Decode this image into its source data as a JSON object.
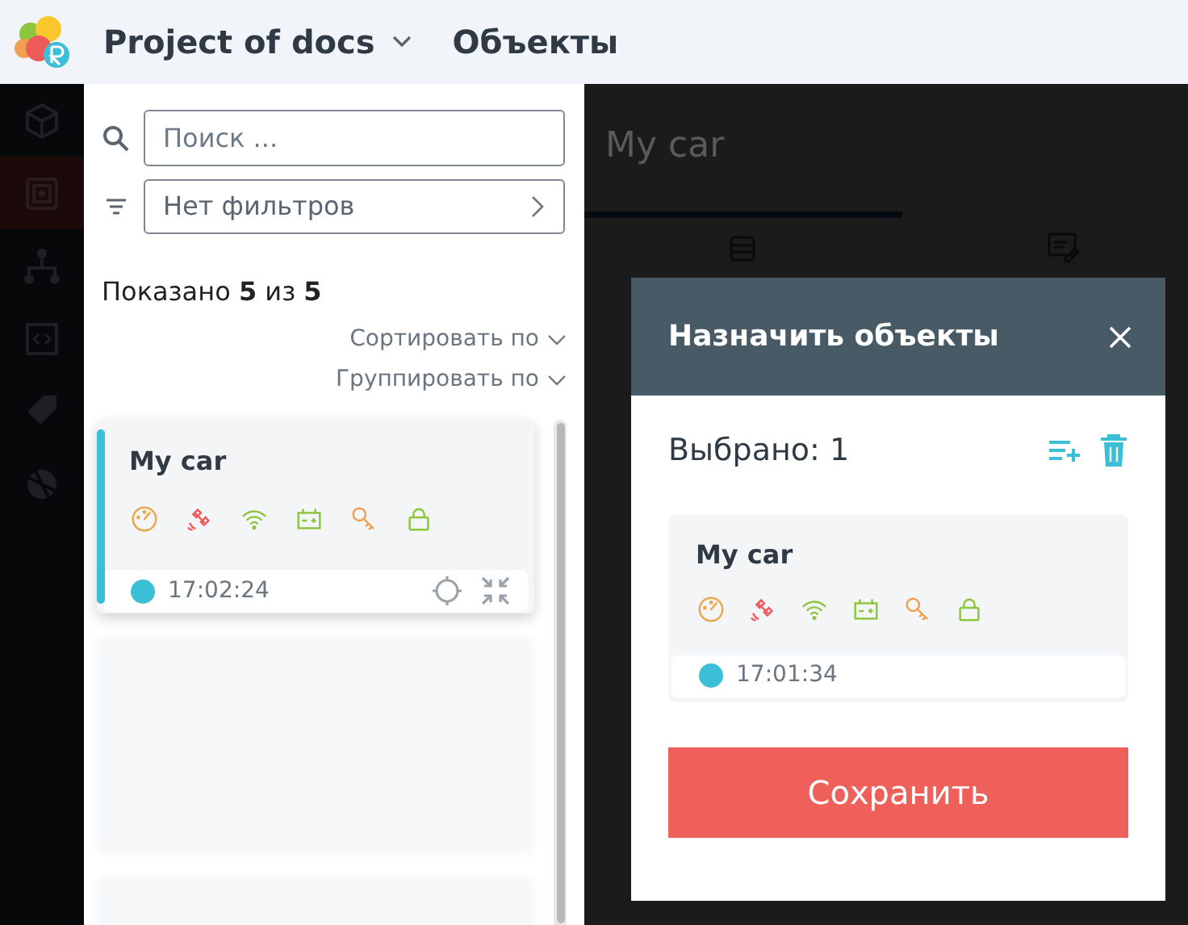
{
  "header": {
    "project": "Project of docs",
    "section": "Объекты"
  },
  "nav": [
    {
      "selected": false
    },
    {
      "selected": true
    },
    {
      "selected": false
    },
    {
      "selected": false
    },
    {
      "selected": false
    },
    {
      "selected": false
    }
  ],
  "list_panel": {
    "search": {
      "placeholder": "Поиск ..."
    },
    "filter": {
      "value": "Нет фильтров"
    },
    "shown": "Показано **5** из **5**",
    "sort": "Сортировать по",
    "group": "Группировать по",
    "objects": [
      {
        "name": "My car",
        "time": "17:02:24",
        "selected": true,
        "color": "#3bbfd6"
      }
    ]
  },
  "background": {
    "tab_title": "My car"
  },
  "modal": {
    "title": "Назначить объекты",
    "selected_count": "Выбрано: 1",
    "objects": [
      {
        "name": "My car",
        "time": "17:01:34",
        "color": "#3bbfd6"
      }
    ],
    "save": "Сохранить"
  }
}
